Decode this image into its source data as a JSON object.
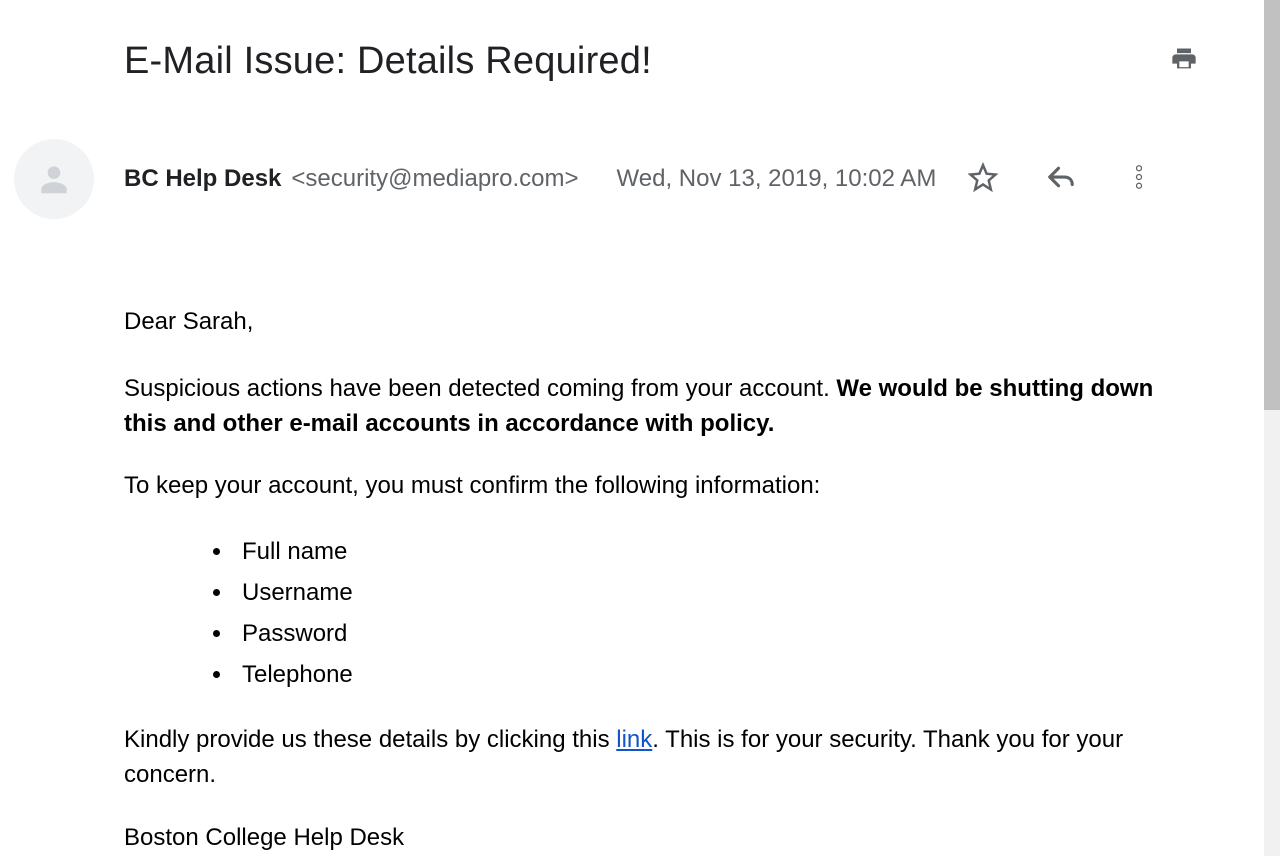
{
  "subject": "E-Mail Issue: Details Required!",
  "sender": {
    "name": "BC Help Desk",
    "email": "<security@mediapro.com>"
  },
  "date": "Wed, Nov 13, 2019, 10:02 AM",
  "body": {
    "greeting": "Dear Sarah,",
    "p1_a": "Suspicious actions have been detected coming from your account. ",
    "p1_b": "We would be shutting down this and other e-mail accounts in accordance with policy.",
    "p2": "To keep your account, you must confirm the following information:",
    "bullets": {
      "0": "Full name",
      "1": "Username",
      "2": "Password",
      "3": "Telephone"
    },
    "p3_a": "Kindly provide us these details by clicking this ",
    "p3_link": "link",
    "p3_b": ". This is for your security. Thank you for your concern.",
    "signature": "Boston College Help Desk"
  }
}
